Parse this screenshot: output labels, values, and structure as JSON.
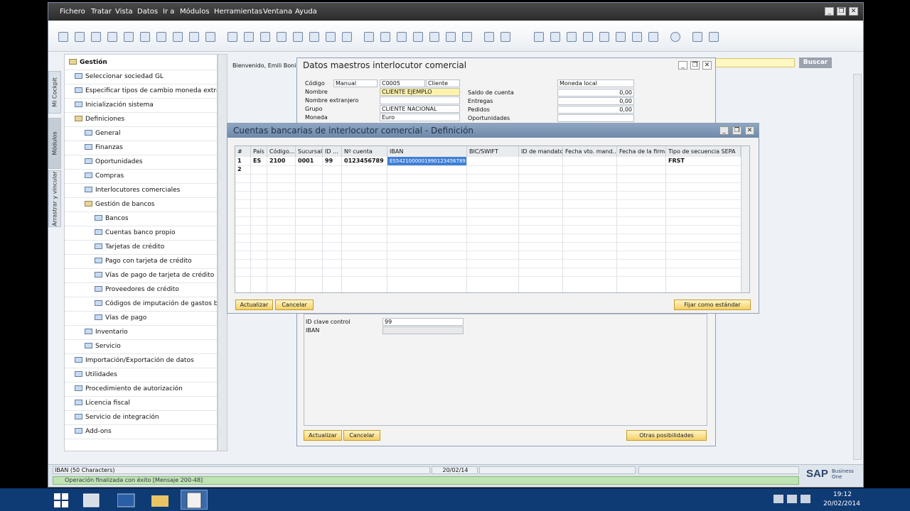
{
  "menu": [
    "Fichero",
    "Tratar",
    "Vista",
    "Datos",
    "Ir a",
    "Módulos",
    "Herramientas",
    "Ventana",
    "Ayuda"
  ],
  "window_controls": {
    "minimize": "_",
    "restore": "❐",
    "close": "✕"
  },
  "left_tabs": [
    "Mi Cockpit",
    "Módulos",
    "Arrastrar y vincular"
  ],
  "welcome": "Bienvenido, Emili Bonilla",
  "search_button": "Buscar",
  "tree": [
    {
      "label": "Gestión",
      "level": 0,
      "folder": true,
      "bold": true
    },
    {
      "label": "Seleccionar sociedad GL",
      "level": 1
    },
    {
      "label": "Especificar tipos de cambio moneda extranjera",
      "level": 1
    },
    {
      "label": "Inicialización sistema",
      "level": 1
    },
    {
      "label": "Definiciones",
      "level": 1,
      "folder": true
    },
    {
      "label": "General",
      "level": 2
    },
    {
      "label": "Finanzas",
      "level": 2
    },
    {
      "label": "Oportunidades",
      "level": 2
    },
    {
      "label": "Compras",
      "level": 2
    },
    {
      "label": "Interlocutores comerciales",
      "level": 2
    },
    {
      "label": "Gestión de bancos",
      "level": 2,
      "folder": true
    },
    {
      "label": "Bancos",
      "level": 3
    },
    {
      "label": "Cuentas banco propio",
      "level": 3
    },
    {
      "label": "Tarjetas de crédito",
      "level": 3
    },
    {
      "label": "Pago con tarjeta de crédito",
      "level": 3
    },
    {
      "label": "Vías de pago de tarjeta de crédito",
      "level": 3
    },
    {
      "label": "Proveedores de crédito",
      "level": 3
    },
    {
      "label": "Códigos de imputación de gastos banc",
      "level": 3
    },
    {
      "label": "Vías de pago",
      "level": 3
    },
    {
      "label": "Inventario",
      "level": 2
    },
    {
      "label": "Servicio",
      "level": 2
    },
    {
      "label": "Importación/Exportación de datos",
      "level": 1
    },
    {
      "label": "Utilidades",
      "level": 1
    },
    {
      "label": "Procedimiento de autorización",
      "level": 1
    },
    {
      "label": "Licencia fiscal",
      "level": 1
    },
    {
      "label": "Servicio de integración",
      "level": 1
    },
    {
      "label": "Add-ons",
      "level": 1
    }
  ],
  "bp_window": {
    "title": "Datos maestros interlocutor comercial",
    "labels": {
      "codigo": "Código",
      "nombre": "Nombre",
      "nombre_ext": "Nombre extranjero",
      "grupo": "Grupo",
      "moneda": "Moneda",
      "saldo": "Saldo de cuenta",
      "entregas": "Entregas",
      "pedidos": "Pedidos",
      "oportunidades": "Oportunidades",
      "id_clave": "ID clave control",
      "iban": "IBAN"
    },
    "values": {
      "codigo_serie": "Manual",
      "codigo": "C0005",
      "tipo": "Cliente",
      "nombre": "CLIENTE EJEMPLO",
      "nombre_ext": "",
      "grupo": "CLIENTE NACIONAL",
      "moneda": "Euro",
      "moneda_local": "Moneda local",
      "saldo": "0,00",
      "entregas": "0,00",
      "pedidos": "0,00",
      "id_clave": "99",
      "iban": ""
    },
    "buttons": {
      "actualizar": "Actualizar",
      "cancelar": "Cancelar",
      "otras": "Otras posibilidades"
    }
  },
  "bank_window": {
    "title": "Cuentas bancarias de interlocutor comercial - Definición",
    "columns": [
      "#",
      "País",
      "Código...",
      "Sucursal",
      "ID ...",
      "Nº cuenta",
      "IBAN",
      "BIC/SWIFT",
      "ID de mandato",
      "Fecha vto. mand...",
      "Fecha de la firma",
      "Tipo de secuencia SEPA"
    ],
    "rows": [
      {
        "n": "1",
        "pais": "ES",
        "codigo": "2100",
        "sucursal": "0001",
        "id": "99",
        "cuenta": "0123456789",
        "iban": "ES5421000001990123456789",
        "bic": "",
        "mandato": "",
        "fecha_vto": "",
        "fecha_firma": "",
        "sepa": "FRST"
      },
      {
        "n": "2",
        "pais": "",
        "codigo": "",
        "sucursal": "",
        "id": "",
        "cuenta": "",
        "iban": "",
        "bic": "",
        "mandato": "",
        "fecha_vto": "",
        "fecha_firma": "",
        "sepa": ""
      }
    ],
    "buttons": {
      "actualizar": "Actualizar",
      "cancelar": "Cancelar",
      "fijar": "Fijar como estándar"
    }
  },
  "status": {
    "field_info": "IBAN (50 Characters)",
    "date": "20/02/14",
    "message": "Operación finalizada con éxito  [Mensaje 200-48]",
    "brand": "SAP",
    "brand_sub": "Business One"
  },
  "taskbar": {
    "time": "19:12",
    "date": "20/02/2014"
  }
}
